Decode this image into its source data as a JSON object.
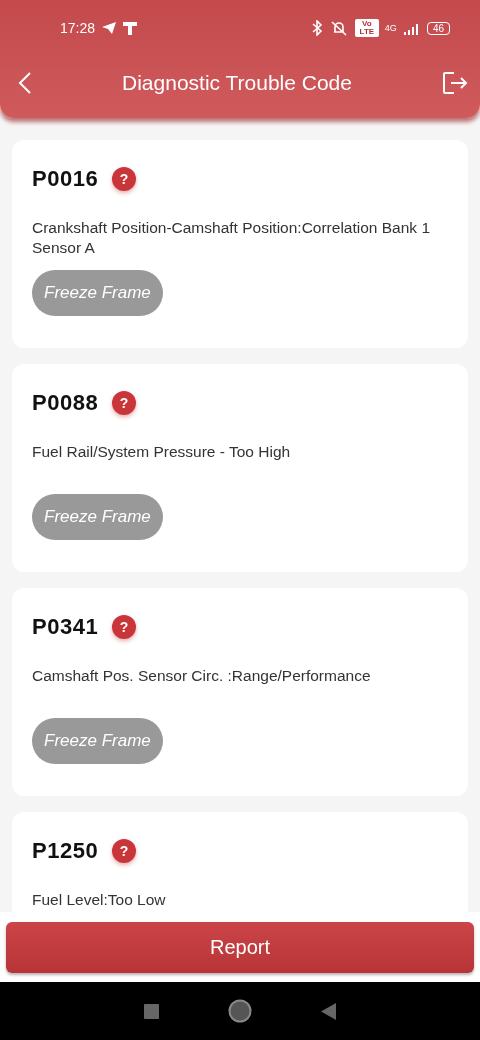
{
  "status_bar": {
    "time": "17:28",
    "volte": "Vo LTE",
    "network": "4G",
    "battery": "46"
  },
  "header": {
    "title": "Diagnostic Trouble Code"
  },
  "codes": [
    {
      "code": "P0016",
      "help": "?",
      "description": "Crankshaft Position-Camshaft Position:Correlation Bank 1 Sensor A",
      "button": "Freeze Frame"
    },
    {
      "code": "P0088",
      "help": "?",
      "description": "Fuel Rail/System Pressure - Too High",
      "button": "Freeze Frame"
    },
    {
      "code": "P0341",
      "help": "?",
      "description": "Camshaft Pos. Sensor Circ. :Range/Performance",
      "button": "Freeze Frame"
    },
    {
      "code": "P1250",
      "help": "?",
      "description": "Fuel Level:Too Low"
    }
  ],
  "report_button": "Report"
}
